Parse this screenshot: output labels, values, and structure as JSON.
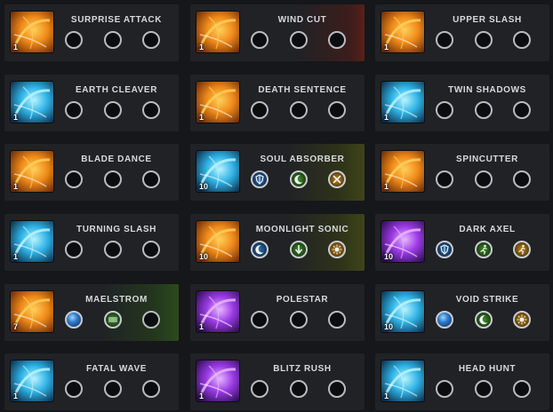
{
  "skills": [
    {
      "name": "SURPRISE ATTACK",
      "level": "1",
      "theme": "orange",
      "highlight": "none",
      "gems": [
        "empty",
        "empty",
        "empty"
      ]
    },
    {
      "name": "WIND CUT",
      "level": "1",
      "theme": "orange",
      "highlight": "red",
      "gems": [
        "empty",
        "empty",
        "empty"
      ]
    },
    {
      "name": "UPPER SLASH",
      "level": "1",
      "theme": "orange",
      "highlight": "none",
      "gems": [
        "empty",
        "empty",
        "empty"
      ]
    },
    {
      "name": "EARTH CLEAVER",
      "level": "1",
      "theme": "blue",
      "highlight": "none",
      "gems": [
        "empty",
        "empty",
        "empty"
      ]
    },
    {
      "name": "DEATH SENTENCE",
      "level": "1",
      "theme": "orange",
      "highlight": "none",
      "gems": [
        "empty",
        "empty",
        "empty"
      ]
    },
    {
      "name": "TWIN SHADOWS",
      "level": "1",
      "theme": "blue",
      "highlight": "none",
      "gems": [
        "empty",
        "empty",
        "empty"
      ]
    },
    {
      "name": "BLADE DANCE",
      "level": "1",
      "theme": "orange",
      "highlight": "none",
      "gems": [
        "empty",
        "empty",
        "empty"
      ]
    },
    {
      "name": "SOUL ABSORBER",
      "level": "10",
      "theme": "blue",
      "highlight": "olive",
      "gems": [
        "blue-shield",
        "green-crescent",
        "gold-cross"
      ]
    },
    {
      "name": "SPINCUTTER",
      "level": "1",
      "theme": "orange",
      "highlight": "none",
      "gems": [
        "empty",
        "empty",
        "empty"
      ]
    },
    {
      "name": "TURNING SLASH",
      "level": "1",
      "theme": "blue",
      "highlight": "none",
      "gems": [
        "empty",
        "empty",
        "empty"
      ]
    },
    {
      "name": "MOONLIGHT SONIC",
      "level": "10",
      "theme": "orange",
      "highlight": "olive",
      "gems": [
        "blue-crescent",
        "green-arrow",
        "gold-burst"
      ]
    },
    {
      "name": "DARK AXEL",
      "level": "10",
      "theme": "purple",
      "highlight": "none",
      "gems": [
        "blue-shield",
        "green-run",
        "gold-run"
      ]
    },
    {
      "name": "MAELSTROM",
      "level": "7",
      "theme": "orange",
      "highlight": "green",
      "gems": [
        "blue-orb",
        "green-lines",
        "empty"
      ]
    },
    {
      "name": "POLESTAR",
      "level": "1",
      "theme": "purple",
      "highlight": "none",
      "gems": [
        "empty",
        "empty",
        "empty"
      ]
    },
    {
      "name": "VOID STRIKE",
      "level": "10",
      "theme": "blue",
      "highlight": "none",
      "gems": [
        "blue-orb",
        "green-crescent",
        "gold-burst"
      ]
    },
    {
      "name": "FATAL WAVE",
      "level": "1",
      "theme": "blue",
      "highlight": "none",
      "gems": [
        "empty",
        "empty",
        "empty"
      ]
    },
    {
      "name": "BLITZ RUSH",
      "level": "1",
      "theme": "purple",
      "highlight": "none",
      "gems": [
        "empty",
        "empty",
        "empty"
      ]
    },
    {
      "name": "HEAD HUNT",
      "level": "1",
      "theme": "blue",
      "highlight": "none",
      "gems": [
        "empty",
        "empty",
        "empty"
      ]
    }
  ],
  "colors": {
    "card_bg": "#202226",
    "page_bg": "#15171a",
    "text": "#d7d9dc",
    "slot_border": "#b9bcc0"
  }
}
